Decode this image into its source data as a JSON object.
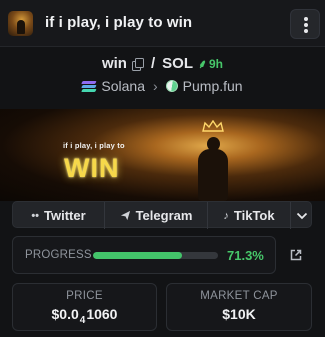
{
  "header": {
    "title": "if i play, i play to win",
    "avatar_icon": "token-avatar",
    "menu_icon": "more-vertical-icon"
  },
  "pair": {
    "symbol": "win",
    "quote": "SOL",
    "separator": "/",
    "age": "9h",
    "age_icon": "sprout-icon",
    "age_color": "#47c76a"
  },
  "chain": {
    "network": "Solana",
    "platform": "Pump.fun"
  },
  "banner": {
    "subtitle": "if i play, i play to",
    "headline": "WIN"
  },
  "socials": {
    "links": [
      {
        "label": "Twitter",
        "icon": "users-icon"
      },
      {
        "label": "Telegram",
        "icon": "send-icon"
      },
      {
        "label": "TikTok",
        "icon": "tiktok-icon"
      }
    ],
    "more_icon": "chevron-down-icon"
  },
  "progress": {
    "label": "PROGRESS",
    "value_text": "71.3%",
    "percent": 71.3,
    "color": "#43c46a"
  },
  "stats": {
    "price": {
      "label": "PRICE",
      "prefix": "$0.0",
      "zeros": "4",
      "suffix": "1060"
    },
    "market_cap": {
      "label": "MARKET CAP",
      "value": "$10K"
    }
  }
}
